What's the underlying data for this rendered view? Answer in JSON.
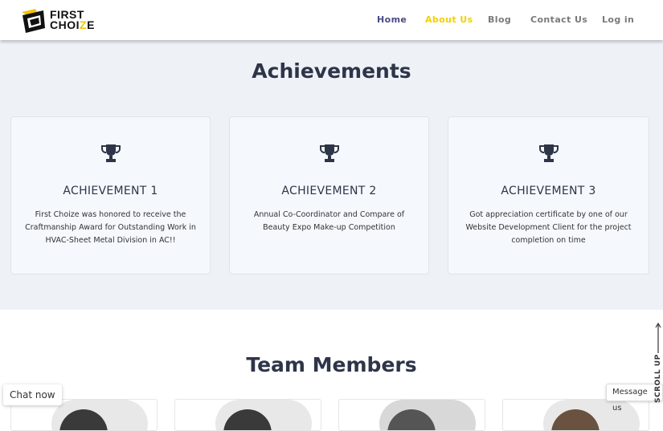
{
  "logo": {
    "line1": "FIRST",
    "line2a": "CHOI",
    "line2b": "Z",
    "line2c": "E"
  },
  "nav": [
    {
      "label": "Home",
      "state": "active"
    },
    {
      "label": "About Us",
      "state": "highlighted"
    },
    {
      "label": "Blog",
      "state": "default"
    },
    {
      "label": "Contact Us",
      "state": "default"
    },
    {
      "label": "Log in",
      "state": "default"
    }
  ],
  "achievements": {
    "title": "Achievements",
    "cards": [
      {
        "title": "ACHIEVEMENT 1",
        "icon": "trophy-icon",
        "description": "First Choize was honored to receive the Craftmanship Award for Outstanding Work in HVAC-Sheet Metal Division in AC!!"
      },
      {
        "title": "ACHIEVEMENT 2",
        "icon": "trophy-icon",
        "description": "Annual Co-Coordinator and Compare of Beauty Expo Make-up Competition"
      },
      {
        "title": "ACHIEVEMENT 3",
        "icon": "trophy-icon",
        "description": "Got appreciation certificate by one of our Website Development Client for the project completion on time"
      }
    ]
  },
  "team": {
    "title": "Team Members"
  },
  "widgets": {
    "chat_now": "Chat now",
    "message_us": "Message us",
    "scroll_up": "SCROLL UP"
  },
  "colors": {
    "accent_yellow": "#f2d000",
    "nav_active": "#4b4a86",
    "heading": "#2e3548",
    "section_bg": "#eef2f7"
  }
}
